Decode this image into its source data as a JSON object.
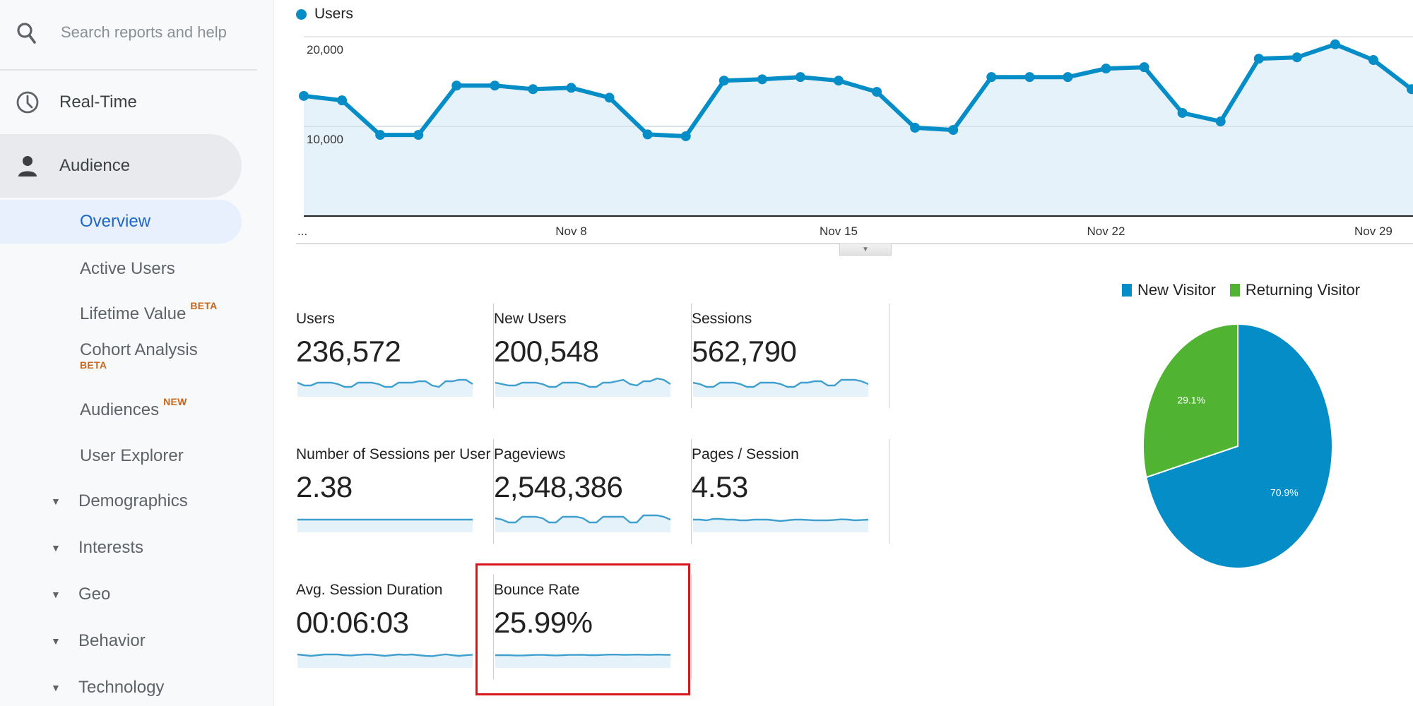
{
  "sidebar": {
    "search": {
      "placeholder": "Search reports and help",
      "icon": "search-icon"
    },
    "realtime": {
      "label": "Real-Time",
      "icon": "clock-icon"
    },
    "audience": {
      "label": "Audience",
      "icon": "person-icon"
    },
    "overview": {
      "label": "Overview"
    },
    "sub_items": [
      {
        "label": "Active Users"
      },
      {
        "label": "Lifetime Value",
        "badge": "BETA"
      },
      {
        "label": "Cohort Analysis",
        "badge": "BETA"
      },
      {
        "label": "Audiences",
        "badge": "NEW"
      },
      {
        "label": "User Explorer"
      }
    ],
    "groups": [
      {
        "label": "Demographics",
        "icon": "caret-down-icon"
      },
      {
        "label": "Interests",
        "icon": "caret-down-icon"
      },
      {
        "label": "Geo",
        "icon": "caret-down-icon"
      },
      {
        "label": "Behavior",
        "icon": "caret-down-icon"
      },
      {
        "label": "Technology",
        "icon": "caret-down-icon"
      }
    ]
  },
  "colors": {
    "accent_blue": "#058dc7",
    "area_fill": "#e6f2f9",
    "green": "#50b432",
    "highlight_red": "#d9141b",
    "badge_orange": "#c7661b",
    "active_nav": "#1a66c9"
  },
  "collapse_toggle": {
    "icon": "triangle-down-icon"
  },
  "chart_data": [
    {
      "type": "area",
      "title": "",
      "legend": [
        "Users"
      ],
      "legend_position": "top-left",
      "ylim": [
        0,
        20000
      ],
      "yticks": [
        "10,000",
        "20,000"
      ],
      "ytick_values": [
        10000,
        20000
      ],
      "x_tick_labels": [
        "...",
        "Nov 8",
        "Nov 15",
        "Nov 22",
        "Nov 29"
      ],
      "x_tick_indices": [
        0,
        7,
        14,
        21,
        28
      ],
      "grid": true,
      "series": [
        {
          "name": "Users",
          "values": [
            13400,
            12900,
            9050,
            9050,
            14550,
            14550,
            14150,
            14300,
            13200,
            9100,
            8900,
            15100,
            15250,
            15500,
            15100,
            13850,
            9850,
            9600,
            15500,
            15500,
            15500,
            16450,
            16600,
            11500,
            10550,
            17550,
            17700,
            19150,
            17400,
            14150
          ]
        }
      ]
    },
    {
      "type": "pie",
      "legend": [
        "New Visitor",
        "Returning Visitor"
      ],
      "legend_position": "top",
      "slices": [
        {
          "name": "New Visitor",
          "value": 70.9,
          "label": "70.9%",
          "color": "#058dc7"
        },
        {
          "name": "Returning Visitor",
          "value": 29.1,
          "label": "29.1%",
          "color": "#50b432"
        }
      ]
    }
  ],
  "metrics": [
    {
      "label": "Users",
      "value": "236,572",
      "spark": [
        6,
        4,
        4,
        6,
        6,
        6,
        5,
        3,
        3,
        6,
        6,
        6,
        5,
        3,
        3,
        6,
        6,
        6,
        7,
        7,
        4,
        3,
        7,
        7,
        8,
        8,
        5
      ]
    },
    {
      "label": "New Users",
      "value": "200,548",
      "spark": [
        6,
        5,
        4,
        4,
        6,
        6,
        6,
        5,
        3,
        3,
        6,
        6,
        6,
        5,
        3,
        3,
        6,
        6,
        7,
        8,
        5,
        4,
        7,
        7,
        9,
        8,
        5
      ]
    },
    {
      "label": "Sessions",
      "value": "562,790",
      "spark": [
        6,
        5,
        3,
        3,
        6,
        6,
        6,
        5,
        3,
        3,
        6,
        6,
        6,
        5,
        3,
        3,
        6,
        6,
        7,
        7,
        4,
        4,
        8,
        8,
        8,
        7,
        5
      ]
    },
    {
      "label": "Number of Sessions per User",
      "value": "2.38",
      "spark": [
        5,
        5,
        5,
        5,
        5,
        5,
        5,
        5,
        5,
        5,
        5,
        5,
        5,
        5,
        5,
        5,
        5,
        5,
        5,
        5,
        5,
        5,
        5,
        5,
        5,
        5,
        5
      ]
    },
    {
      "label": "Pageviews",
      "value": "2,548,386",
      "spark": [
        6,
        5,
        3,
        3,
        7,
        7,
        7,
        6,
        3,
        3,
        7,
        7,
        7,
        6,
        3,
        3,
        7,
        7,
        7,
        7,
        3,
        3,
        8,
        8,
        8,
        7,
        5
      ]
    },
    {
      "label": "Pages / Session",
      "value": "4.53",
      "spark": [
        5,
        5,
        4.5,
        5.5,
        5.5,
        5,
        5,
        4.5,
        4.5,
        5,
        5,
        5,
        4.5,
        4,
        4.5,
        5,
        5,
        4.8,
        4.5,
        4.5,
        4.5,
        4.8,
        5.2,
        5,
        4.5,
        4.7,
        5
      ]
    },
    {
      "label": "Avg. Session Duration",
      "value": "00:06:03",
      "spark": [
        5.5,
        5,
        4.5,
        5,
        5.5,
        5.5,
        5.5,
        5,
        4.8,
        5.2,
        5.5,
        5.5,
        5,
        4.5,
        5,
        5.5,
        5.2,
        5.5,
        5,
        4.5,
        4.3,
        5,
        5.6,
        5,
        4.5,
        5,
        5.3
      ]
    },
    {
      "label": "Bounce Rate",
      "value": "25.99%",
      "spark": [
        5,
        5,
        5,
        4.8,
        4.8,
        5,
        5.2,
        5.2,
        5,
        4.8,
        5,
        5.2,
        5.2,
        5.3,
        5,
        5,
        5.2,
        5.4,
        5.4,
        5.2,
        5.3,
        5.4,
        5.3,
        5.2,
        5.4,
        5.3,
        5.2
      ]
    }
  ]
}
